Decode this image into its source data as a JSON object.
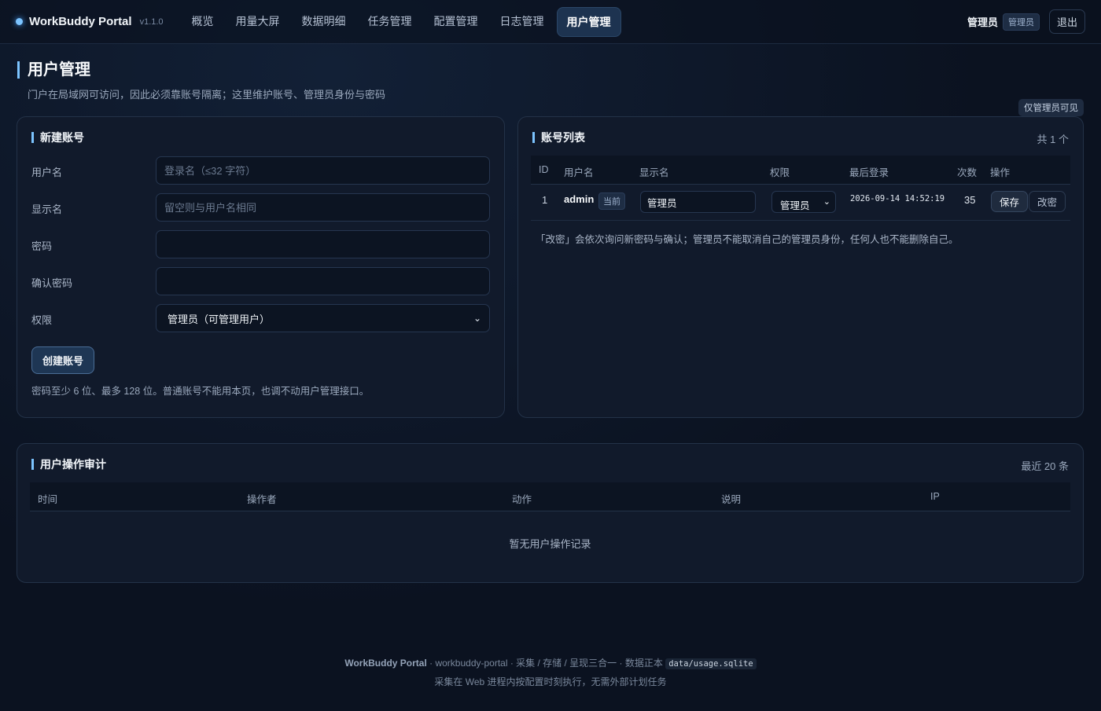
{
  "app": {
    "name": "WorkBuddy Portal",
    "version": "v1.1.0"
  },
  "nav": {
    "items": [
      {
        "label": "概览"
      },
      {
        "label": "用量大屏"
      },
      {
        "label": "数据明细"
      },
      {
        "label": "任务管理"
      },
      {
        "label": "配置管理"
      },
      {
        "label": "日志管理"
      },
      {
        "label": "用户管理",
        "active": true
      }
    ]
  },
  "user": {
    "name": "管理员",
    "role_badge": "管理员",
    "logout_label": "退出"
  },
  "page": {
    "title": "用户管理",
    "subtitle": "门户在局域网可访问，因此必须靠账号隔离；这里维护账号、管理员身份与密码",
    "admin_only_badge": "仅管理员可见"
  },
  "create_form": {
    "title": "新建账号",
    "fields": {
      "username": {
        "label": "用户名",
        "placeholder": "登录名（≤32 字符）",
        "value": ""
      },
      "display_name": {
        "label": "显示名",
        "placeholder": "留空则与用户名相同",
        "value": ""
      },
      "password": {
        "label": "密码",
        "value": ""
      },
      "confirm_password": {
        "label": "确认密码",
        "value": ""
      },
      "role": {
        "label": "权限",
        "selected": "管理员（可管理用户）"
      }
    },
    "submit_label": "创建账号",
    "hint": "密码至少 6 位、最多 128 位。普通账号不能用本页，也调不动用户管理接口。"
  },
  "account_list": {
    "title": "账号列表",
    "count_text": "共 1 个",
    "columns": [
      "ID",
      "用户名",
      "显示名",
      "权限",
      "最后登录",
      "次数",
      "操作"
    ],
    "rows": [
      {
        "id": "1",
        "username": "admin",
        "current_badge": "当前",
        "display_name": "管理员",
        "role": "管理员",
        "last_login": "2026-09-14 14:52:19",
        "count": "35",
        "save_label": "保存",
        "change_pwd_label": "改密"
      }
    ],
    "note": "「改密」会依次询问新密码与确认；管理员不能取消自己的管理员身份，任何人也不能删除自己。"
  },
  "audit": {
    "title": "用户操作审计",
    "meta": "最近 20 条",
    "columns": [
      "时间",
      "操作者",
      "动作",
      "说明",
      "IP"
    ],
    "empty_text": "暂无用户操作记录"
  },
  "footer": {
    "brand": "WorkBuddy Portal",
    "line1_text": " · workbuddy-portal · 采集 / 存储 / 呈现三合一 · 数据正本 ",
    "db_path": "data/usage.sqlite",
    "line2": "采集在 Web 进程内按配置时刻执行，无需外部计划任务"
  },
  "colors": {
    "accent": "#7cc4ff",
    "background": "#0b1220",
    "card": "#111a2b",
    "active_nav": "#1d3350"
  }
}
